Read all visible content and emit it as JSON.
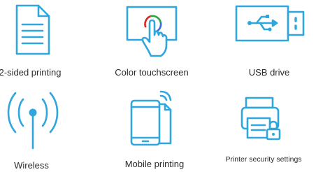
{
  "features": [
    {
      "icon": "document-icon",
      "label": "2-sided printing"
    },
    {
      "icon": "touchscreen-icon",
      "label": "Color touchscreen"
    },
    {
      "icon": "usb-drive-icon",
      "label": "USB drive"
    },
    {
      "icon": "wireless-icon",
      "label": "Wireless"
    },
    {
      "icon": "mobile-printing-icon",
      "label": "Mobile printing"
    },
    {
      "icon": "printer-lock-icon",
      "label": "Printer security settings"
    }
  ],
  "colors": {
    "icon_stroke": "#2fa6dd",
    "label_text": "#2b2b2b",
    "touch_red": "#e2231a",
    "touch_green": "#27a844",
    "touch_blue": "#2f6fdd"
  }
}
